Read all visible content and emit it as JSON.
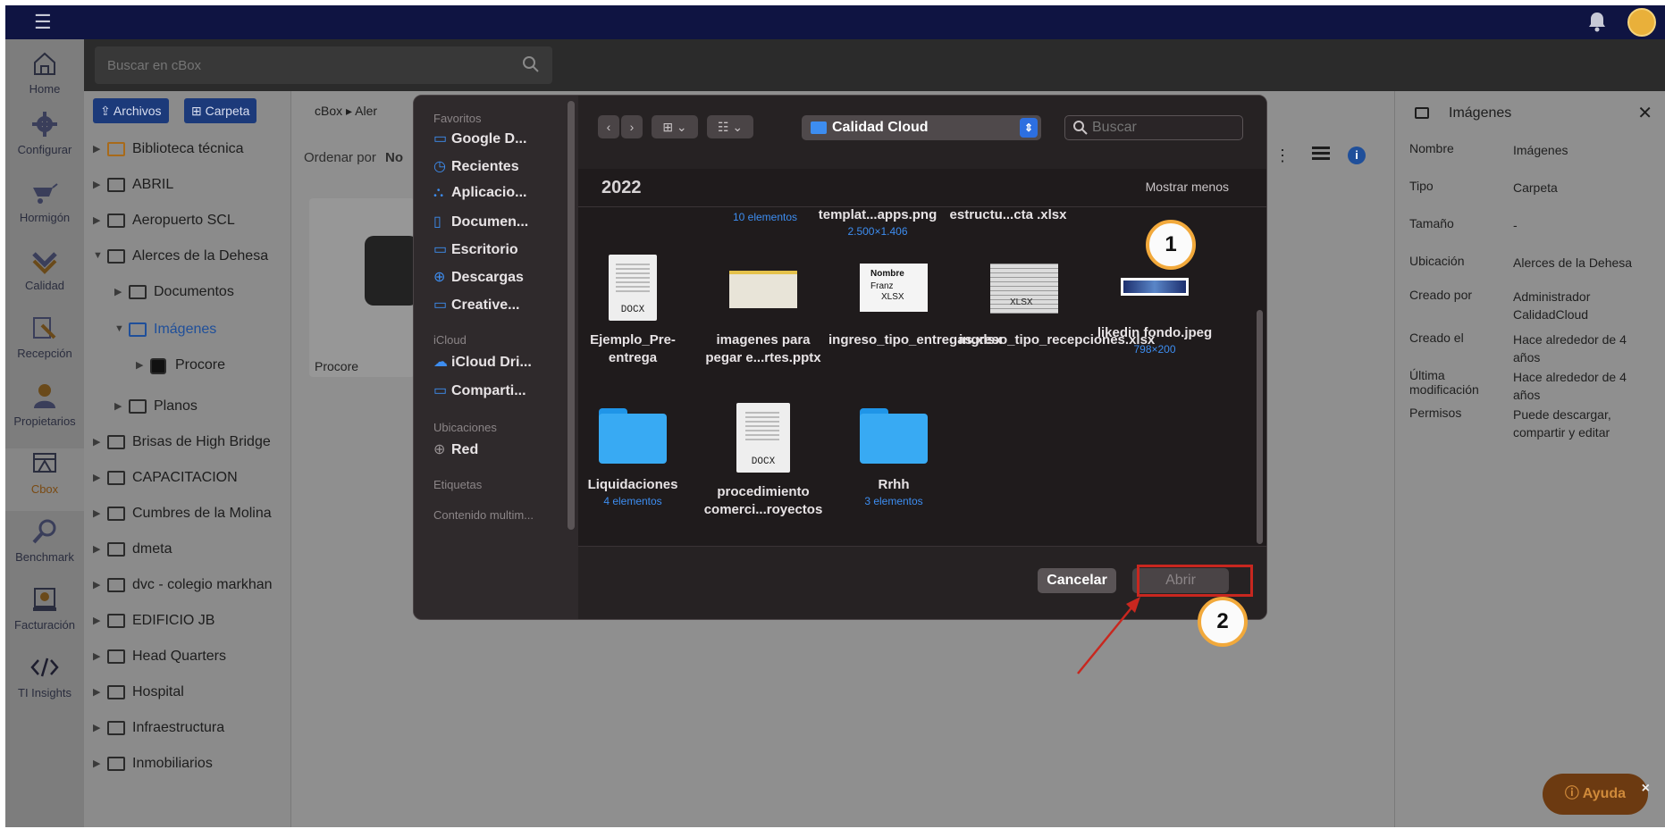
{
  "topbar": {
    "menu_icon": "hamburger-icon",
    "bell_icon": "bell-icon",
    "avatar_icon": "user-avatar"
  },
  "nav": [
    {
      "label": "Home",
      "icon": "home-icon"
    },
    {
      "label": "Configurar",
      "icon": "gear-icon"
    },
    {
      "label": "Hormigón",
      "icon": "wheelbarrow-icon"
    },
    {
      "label": "Calidad",
      "icon": "quality-icon"
    },
    {
      "label": "Recepción",
      "icon": "reception-icon"
    },
    {
      "label": "Propietarios",
      "icon": "owners-icon"
    },
    {
      "label": "Cbox",
      "icon": "cbox-icon"
    },
    {
      "label": "Benchmark",
      "icon": "benchmark-icon"
    },
    {
      "label": "Facturación",
      "icon": "billing-icon"
    },
    {
      "label": "TI Insights",
      "icon": "code-icon"
    }
  ],
  "search": {
    "placeholder": "Buscar en cBox"
  },
  "tree": {
    "btn_files": "Archivos",
    "btn_folder": "Carpeta",
    "items": [
      {
        "label": "Biblioteca técnica",
        "depth": 0
      },
      {
        "label": "ABRIL",
        "depth": 0
      },
      {
        "label": "Aeropuerto SCL",
        "depth": 0
      },
      {
        "label": "Alerces de la Dehesa",
        "depth": 0
      },
      {
        "label": "Documentos",
        "depth": 1
      },
      {
        "label": "Imágenes",
        "depth": 1
      },
      {
        "label": "Procore",
        "depth": 2
      },
      {
        "label": "Planos",
        "depth": 1
      },
      {
        "label": "Brisas de High Bridge",
        "depth": 0
      },
      {
        "label": "CAPACITACION",
        "depth": 0
      },
      {
        "label": "Cumbres de la Molina",
        "depth": 0
      },
      {
        "label": "dmeta",
        "depth": 0
      },
      {
        "label": "dvc - colegio markhan",
        "depth": 0
      },
      {
        "label": "EDIFICIO JB",
        "depth": 0
      },
      {
        "label": "Head Quarters",
        "depth": 0
      },
      {
        "label": "Hospital",
        "depth": 0
      },
      {
        "label": "Infraestructura",
        "depth": 0
      },
      {
        "label": "Inmobiliarios",
        "depth": 0
      }
    ]
  },
  "main": {
    "breadcrumb": [
      "cBox",
      "Aler"
    ],
    "sort_label": "Ordenar por",
    "sort_value": "No",
    "card_title": "Procore"
  },
  "details": {
    "title": "Imágenes",
    "rows": [
      {
        "k": "Nombre",
        "v": "Imágenes"
      },
      {
        "k": "Tipo",
        "v": "Carpeta"
      },
      {
        "k": "Tamaño",
        "v": "-"
      },
      {
        "k": "Ubicación",
        "v": "Alerces de la Dehesa"
      },
      {
        "k": "Creado por",
        "v": "Administrador CalidadCloud"
      },
      {
        "k": "Creado el",
        "v": "Hace alrededor de 4 años"
      },
      {
        "k": "Última modificación",
        "v": "Hace alrededor de 4 años"
      },
      {
        "k": "Permisos",
        "v": "Puede descargar, compartir y editar"
      }
    ]
  },
  "help": {
    "label": "Ayuda"
  },
  "dialog": {
    "sidebar": {
      "favorites_header": "Favoritos",
      "favorites": [
        "Google D...",
        "Recientes",
        "Aplicacio...",
        "Documen...",
        "Escritorio",
        "Descargas",
        "Creative..."
      ],
      "icloud_header": "iCloud",
      "icloud": [
        "iCloud Dri...",
        "Comparti..."
      ],
      "locations_header": "Ubicaciones",
      "locations": [
        "Red"
      ],
      "tags_header": "Etiquetas",
      "media_header": "Contenido multim..."
    },
    "location": "Calidad Cloud",
    "search_placeholder": "Buscar",
    "year": "2022",
    "show_less": "Mostrar menos",
    "top_row": [
      {
        "name": "",
        "meta": "10 elementos"
      },
      {
        "name": "templat...apps.png",
        "meta": "2.500×1.406"
      },
      {
        "name": "estructu...cta .xlsx",
        "meta": ""
      }
    ],
    "files": [
      {
        "name": "Ejemplo_Pre-entrega",
        "meta": "",
        "kind": "docx",
        "tag": "DOCX"
      },
      {
        "name": "imagenes para pegar e...rtes.pptx",
        "meta": "",
        "kind": "pptx"
      },
      {
        "name": "ingreso_tipo_entregas.xlsx",
        "meta": "",
        "kind": "xlsx-name",
        "tag": "XLSX",
        "thumb_text": [
          "Nombre",
          "Franz"
        ]
      },
      {
        "name": "ingreso_tipo_recepciones.xlsx",
        "meta": "",
        "kind": "xlsx",
        "tag": "XLSX"
      },
      {
        "name": "likedin fondo.jpeg",
        "meta": "798×200",
        "kind": "jpeg"
      },
      {
        "name": "Liquidaciones",
        "meta": "4 elementos",
        "kind": "folder"
      },
      {
        "name": "procedimiento comerci...royectos",
        "meta": "",
        "kind": "docx",
        "tag": "DOCX"
      },
      {
        "name": "Rrhh",
        "meta": "3 elementos",
        "kind": "folder"
      }
    ],
    "cancel_label": "Cancelar",
    "open_label": "Abrir"
  },
  "annotations": {
    "step1": "1",
    "step2": "2"
  }
}
